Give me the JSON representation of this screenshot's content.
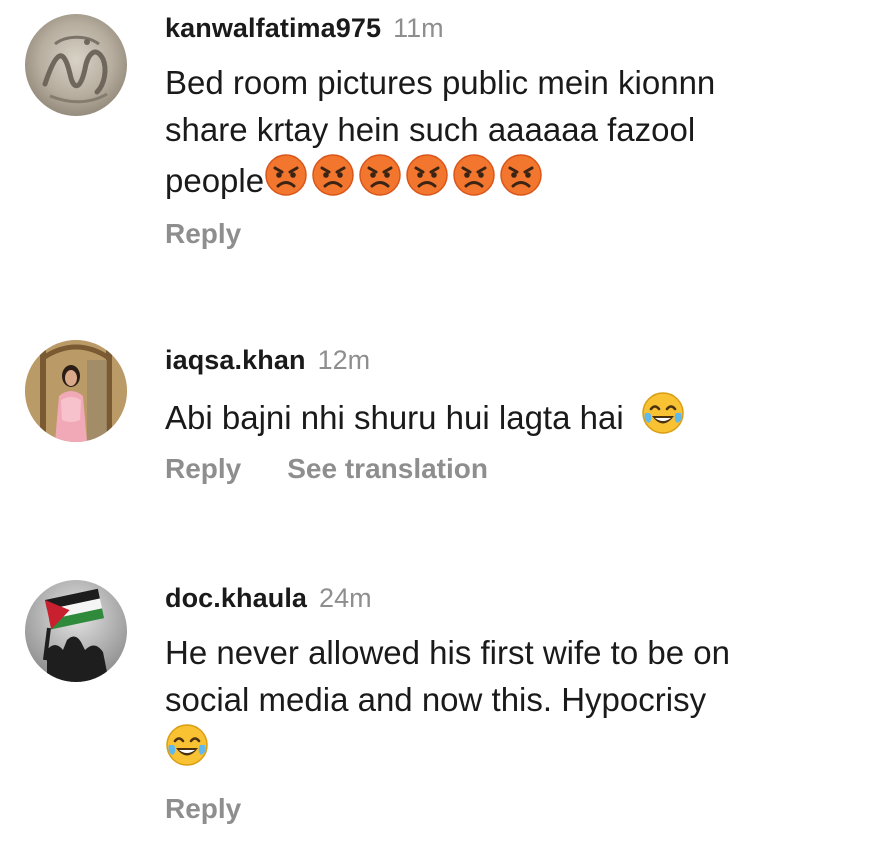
{
  "comments": [
    {
      "username": "kanwalfatima975",
      "time": "11m",
      "text_line1": "Bed room pictures public mein kionnn",
      "text_line2": "share krtay hein such aaaaaa fazool",
      "text_line3": "people",
      "reply_label": "Reply",
      "emoji_name": "angry-face-emoji"
    },
    {
      "username": "iaqsa.khan",
      "time": "12m",
      "text_line1": "Abi bajni nhi shuru hui lagta hai",
      "reply_label": "Reply",
      "translation_label": "See translation",
      "emoji_name": "tears-of-joy-emoji"
    },
    {
      "username": "doc.khaula",
      "time": "24m",
      "text_line1": "He never allowed his first wife to be on",
      "text_line2": "social media and now this. Hypocrisy",
      "reply_label": "Reply",
      "emoji_name": "tears-of-joy-emoji"
    }
  ],
  "colors": {
    "text": "#1a1a1a",
    "muted": "#8e8e8e",
    "angry_emoji": "#f2762e",
    "joy_emoji": "#f9c232"
  }
}
